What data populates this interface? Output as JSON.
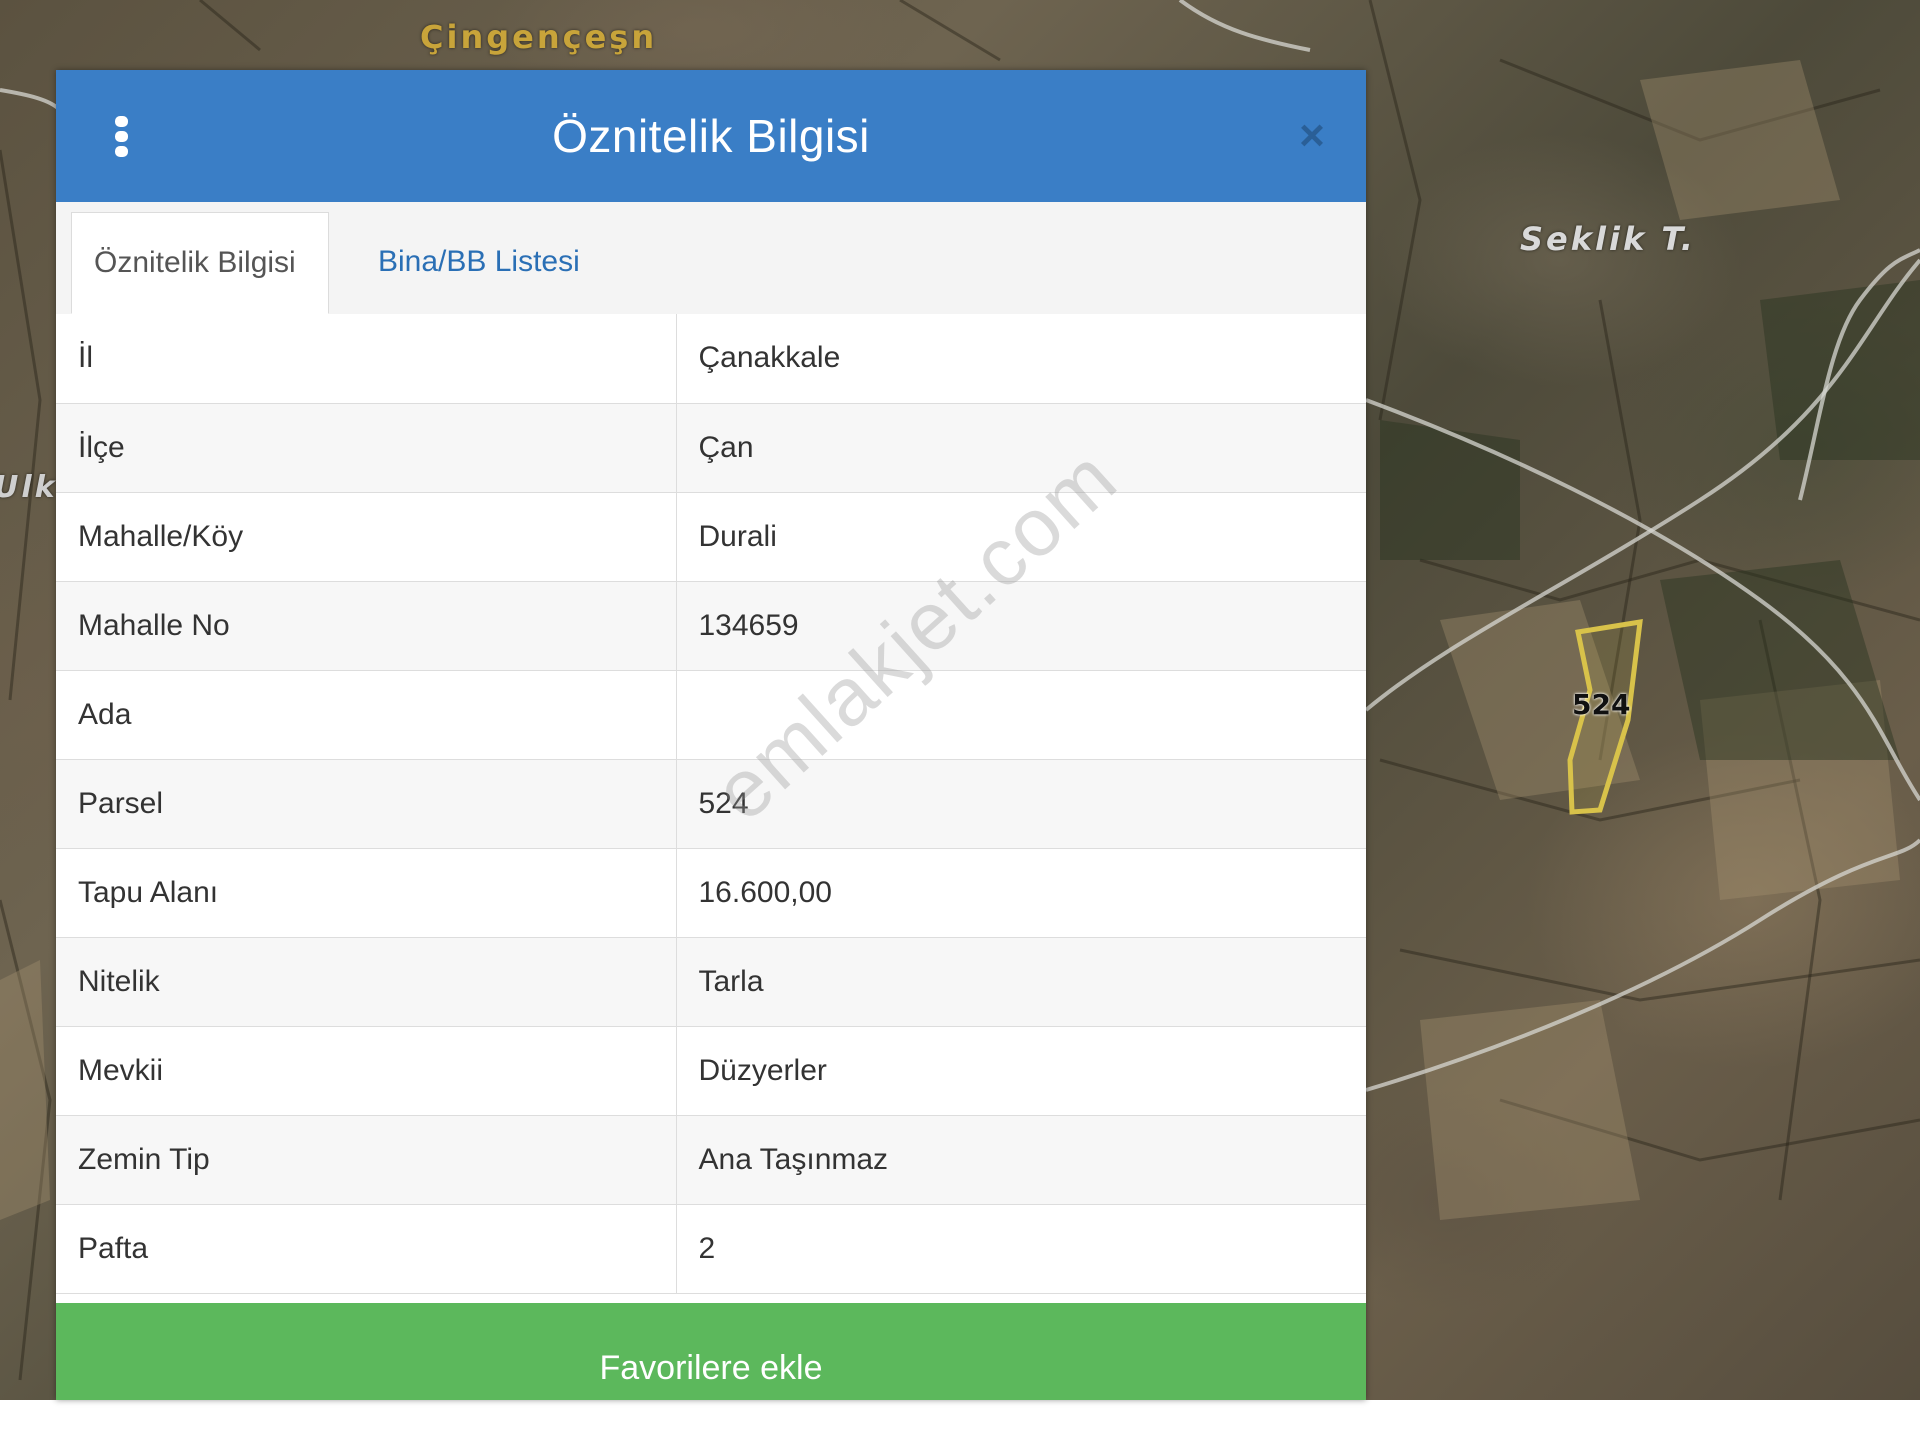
{
  "map": {
    "label_north": "Çingençeşn",
    "label_seklik": "Seklik T.",
    "label_west": "Ulk",
    "parcel_number": "524",
    "parcel_outline_color": "#d8c24a"
  },
  "dialog": {
    "title": "Öznitelik Bilgisi",
    "menu_icon": "kebab-menu-icon",
    "close_icon": "close-icon",
    "header_color": "#3a7ec6",
    "tabs": [
      {
        "label": "Öznitelik Bilgisi",
        "active": true
      },
      {
        "label": "Bina/BB Listesi",
        "active": false
      }
    ],
    "attributes": [
      {
        "label": "İl",
        "value": "Çanakkale"
      },
      {
        "label": "İlçe",
        "value": "Çan"
      },
      {
        "label": "Mahalle/Köy",
        "value": "Durali"
      },
      {
        "label": "Mahalle No",
        "value": "134659"
      },
      {
        "label": "Ada",
        "value": ""
      },
      {
        "label": "Parsel",
        "value": "524"
      },
      {
        "label": "Tapu Alanı",
        "value": "16.600,00"
      },
      {
        "label": "Nitelik",
        "value": "Tarla"
      },
      {
        "label": "Mevkii",
        "value": "Düzyerler"
      },
      {
        "label": "Zemin Tip",
        "value": "Ana Taşınmaz"
      },
      {
        "label": "Pafta",
        "value": "2"
      }
    ],
    "favorite_button_label": "Favorilere ekle",
    "favorite_button_color": "#5cb85c"
  },
  "watermark": "emlakjet.com"
}
